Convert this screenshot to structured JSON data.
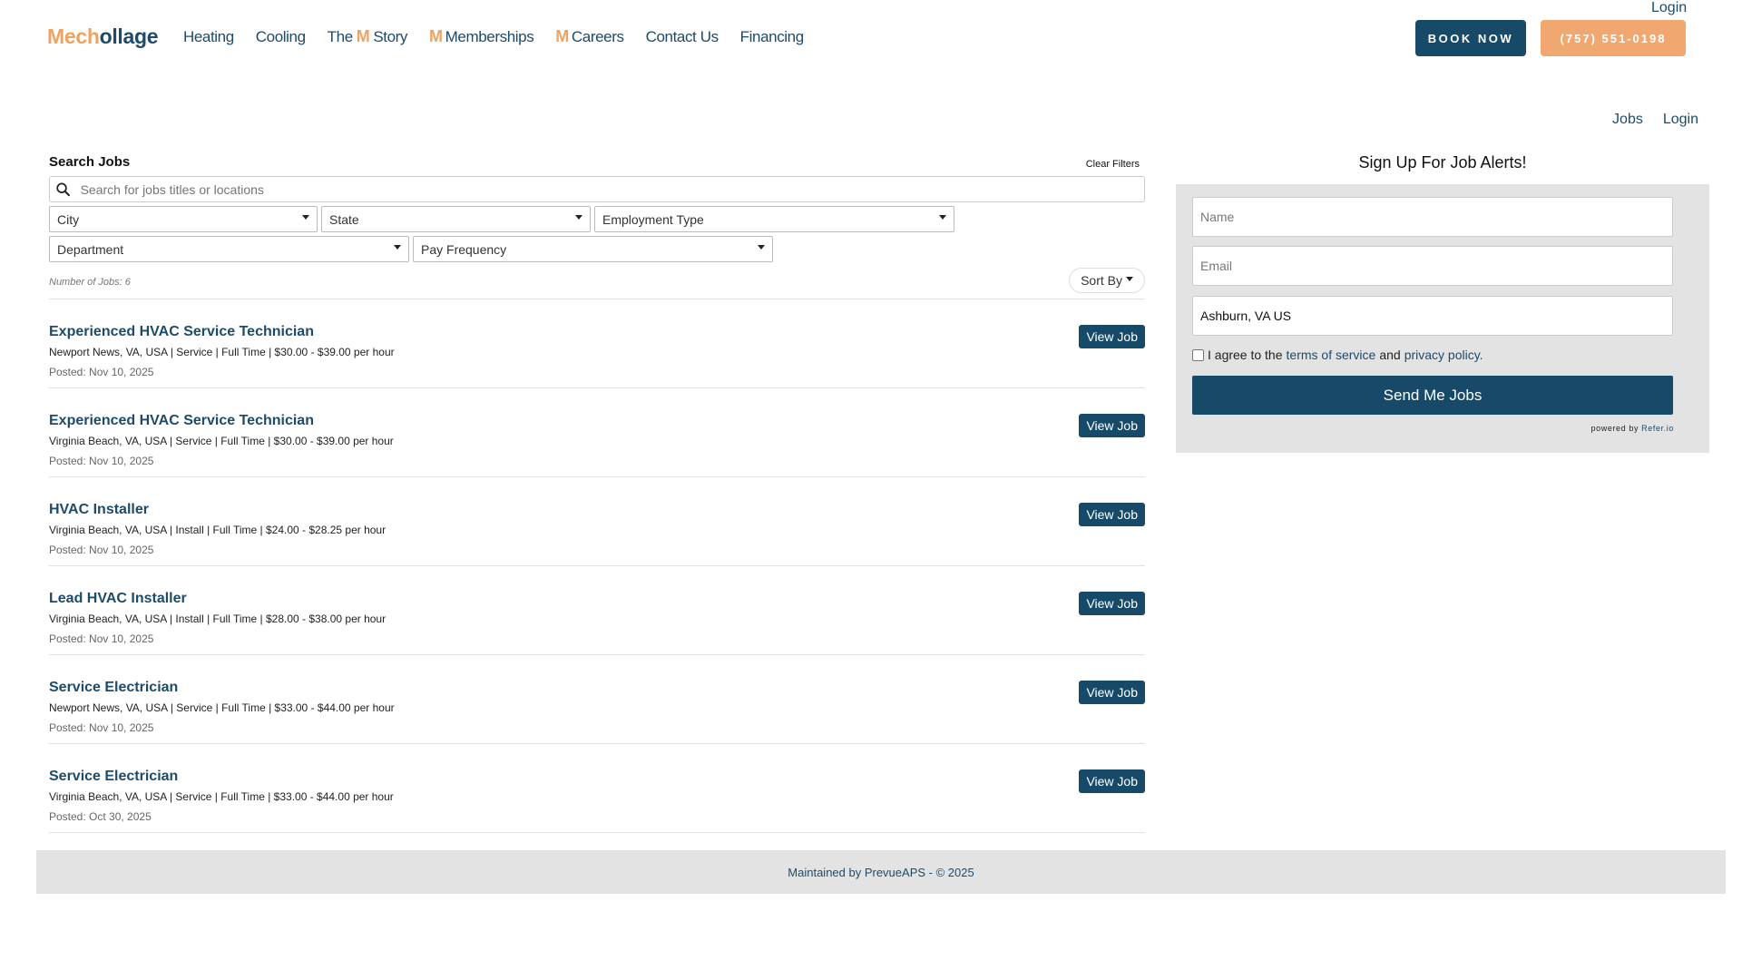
{
  "header": {
    "top_login": "Login",
    "logo_part1": "Mech",
    "logo_part2": "ollage",
    "nav": {
      "heating": "Heating",
      "cooling": "Cooling",
      "story_prefix": "The",
      "story_m": "M",
      "story_suffix": "Story",
      "memberships_m": "M",
      "memberships": "Memberships",
      "careers_m": "M",
      "careers": "Careers",
      "contact": "Contact Us",
      "financing": "Financing"
    },
    "book_now": "BOOK NOW",
    "phone": "(757) 551-0198"
  },
  "subnav": {
    "jobs": "Jobs",
    "login": "Login"
  },
  "search": {
    "title": "Search Jobs",
    "clear_filters": "Clear Filters",
    "placeholder": "Search for jobs titles or locations",
    "filters": {
      "city": "City",
      "state": "State",
      "employment_type": "Employment Type",
      "department": "Department",
      "pay_frequency": "Pay Frequency"
    },
    "job_count": "Number of Jobs: 6",
    "sort_by": "Sort By"
  },
  "jobs": [
    {
      "title": "Experienced HVAC Service Technician",
      "meta": "Newport News, VA, USA | Service | Full Time | $30.00 - $39.00 per hour",
      "posted": "Posted: Nov 10, 2025",
      "button": "View Job"
    },
    {
      "title": "Experienced HVAC Service Technician",
      "meta": "Virginia Beach, VA, USA | Service | Full Time | $30.00 - $39.00 per hour",
      "posted": "Posted: Nov 10, 2025",
      "button": "View Job"
    },
    {
      "title": "HVAC Installer",
      "meta": "Virginia Beach, VA, USA | Install | Full Time | $24.00 - $28.25 per hour",
      "posted": "Posted: Nov 10, 2025",
      "button": "View Job"
    },
    {
      "title": "Lead HVAC Installer",
      "meta": "Virginia Beach, VA, USA | Install | Full Time | $28.00 - $38.00 per hour",
      "posted": "Posted: Nov 10, 2025",
      "button": "View Job"
    },
    {
      "title": "Service Electrician",
      "meta": "Newport News, VA, USA | Service | Full Time | $33.00 - $44.00 per hour",
      "posted": "Posted: Nov 10, 2025",
      "button": "View Job"
    },
    {
      "title": "Service Electrician",
      "meta": "Virginia Beach, VA, USA | Service | Full Time | $33.00 - $44.00 per hour",
      "posted": "Posted: Oct 30, 2025",
      "button": "View Job"
    }
  ],
  "alerts": {
    "title": "Sign Up For Job Alerts!",
    "name_placeholder": "Name",
    "email_placeholder": "Email",
    "location_value": "Ashburn, VA US",
    "agree_prefix": "I agree to the",
    "terms": "terms of service",
    "and": "and",
    "privacy": "privacy policy.",
    "send": "Send Me Jobs",
    "powered_by": "powered by",
    "powered_brand": "Refer.io"
  },
  "footer": {
    "text": "Maintained by PrevueAPS - © 2025"
  },
  "colors": {
    "brand_navy": "#174a69",
    "brand_orange": "#f0a35e",
    "panel_gray": "#e3e3e3"
  }
}
